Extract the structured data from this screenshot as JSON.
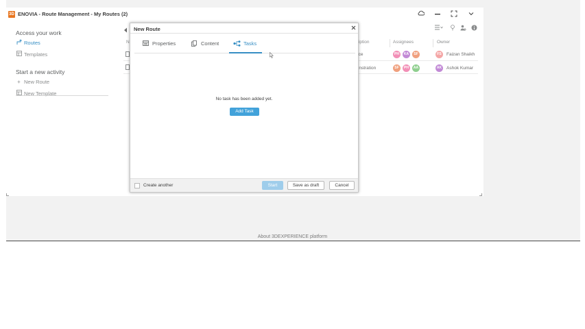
{
  "app": {
    "logo_text": "3D",
    "title": "ENOVIA - Route Management - My Routes (2)"
  },
  "left_panel": {
    "access_title": "Access your work",
    "access_items": [
      {
        "label": "Routes",
        "icon": "route-icon"
      },
      {
        "label": "Templates",
        "icon": "template-icon"
      }
    ],
    "start_title": "Start a new activity",
    "start_items": [
      {
        "label": "New Route",
        "icon": "plus-icon"
      },
      {
        "label": "New Template",
        "icon": "new-template-icon"
      }
    ]
  },
  "list": {
    "columns": [
      "Name",
      "Description",
      "Assignees",
      "Owner"
    ],
    "rows": [
      {
        "description": "Practice",
        "assignees": [
          "PH",
          "KA",
          "SF"
        ],
        "owner_initials": "FS",
        "owner": "Faizan Shaikh"
      },
      {
        "description": "Demonstration",
        "assignees": [
          "SF",
          "PH",
          "AA"
        ],
        "owner_initials": "AK",
        "owner": "Ashok Kumar"
      }
    ]
  },
  "modal": {
    "title": "New Route",
    "tabs": [
      {
        "label": "Properties",
        "icon": "properties-icon"
      },
      {
        "label": "Content",
        "icon": "content-icon"
      },
      {
        "label": "Tasks",
        "icon": "tasks-icon"
      }
    ],
    "active_tab": "Tasks",
    "empty_message": "No task has been added yet.",
    "add_task_label": "Add Task",
    "footer": {
      "create_another": "Create another",
      "start": "Start",
      "save_as_draft": "Save as draft",
      "cancel": "Cancel"
    }
  },
  "footer": {
    "about": "About 3DEXPERIENCE platform"
  },
  "colors": {
    "accent": "#368ec4",
    "button_primary": "#42a2da",
    "logo": "#e87722"
  }
}
